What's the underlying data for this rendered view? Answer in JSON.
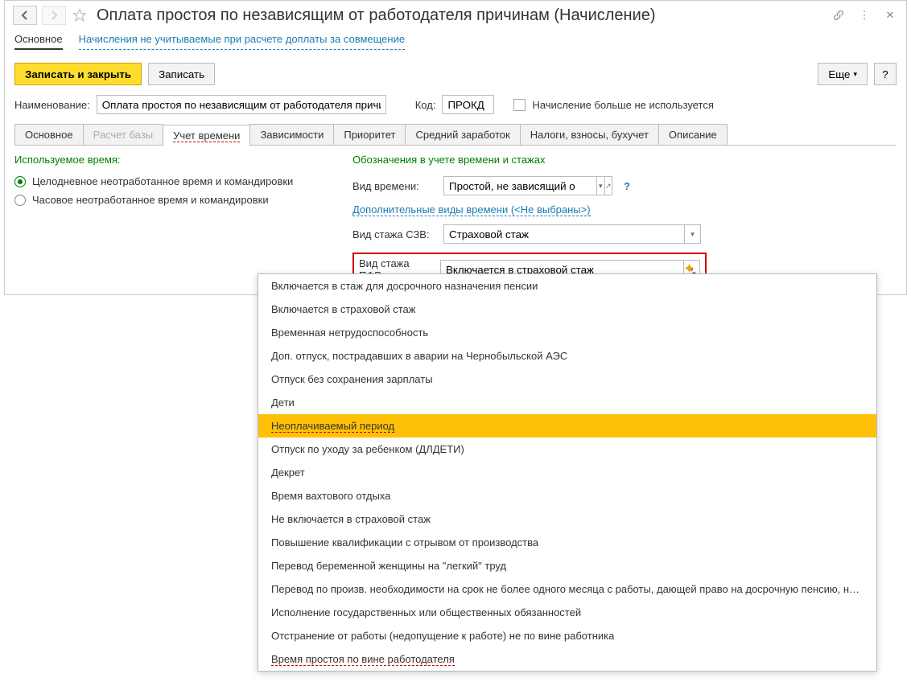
{
  "header": {
    "title": "Оплата простоя по независящим от работодателя причинам (Начисление)"
  },
  "sections": {
    "main": "Основное",
    "link": "Начисления не учитываемые при расчете доплаты за совмещение"
  },
  "actions": {
    "save_close": "Записать и закрыть",
    "save": "Записать",
    "more": "Еще",
    "help": "?"
  },
  "form": {
    "name_label": "Наименование:",
    "name_value": "Оплата простоя по независящим от работодателя причинам",
    "code_label": "Код:",
    "code_value": "ПРОКД",
    "not_used_label": "Начисление больше не используется"
  },
  "tabs": [
    "Основное",
    "Расчет базы",
    "Учет времени",
    "Зависимости",
    "Приоритет",
    "Средний заработок",
    "Налоги, взносы, бухучет",
    "Описание"
  ],
  "time_tab": {
    "used_time_label": "Используемое время:",
    "radio1": "Целодневное неотработанное время и командировки",
    "radio2": "Часовое неотработанное время и командировки",
    "designations_label": "Обозначения в учете времени и стажах",
    "time_type_label": "Вид времени:",
    "time_type_value": "Простой, не зависящий о",
    "additional_link": "Дополнительные виды времени (<Не выбраны>)",
    "szv_label": "Вид стажа СЗВ:",
    "szv_value": "Страховой стаж",
    "pfr_label": "Вид стажа ПФР:",
    "pfr_value": "Включается в страховой стаж"
  },
  "dropdown": [
    "Включается в стаж для досрочного назначения пенсии",
    "Включается в страховой стаж",
    "Временная нетрудоспособность",
    "Доп. отпуск, пострадавших в аварии на Чернобыльской АЭС",
    "Отпуск без сохранения зарплаты",
    "Дети",
    "Неоплачиваемый период",
    "Отпуск по уходу за ребенком (ДЛДЕТИ)",
    "Декрет",
    "Время вахтового отдыха",
    "Не включается в страховой стаж",
    "Повышение квалификации с отрывом от производства",
    "Перевод беременной женщины на \"легкий\" труд",
    "Перевод по произв. необходимости на срок не более одного месяца с работы, дающей право на досрочную пенсию, на другую работу",
    "Исполнение государственных или общественных обязанностей",
    "Отстранение от работы (недопущение к работе) не по вине работника",
    "Время простоя по вине работодателя"
  ],
  "dropdown_hover": 6,
  "dropdown_underline": [
    6,
    16
  ]
}
